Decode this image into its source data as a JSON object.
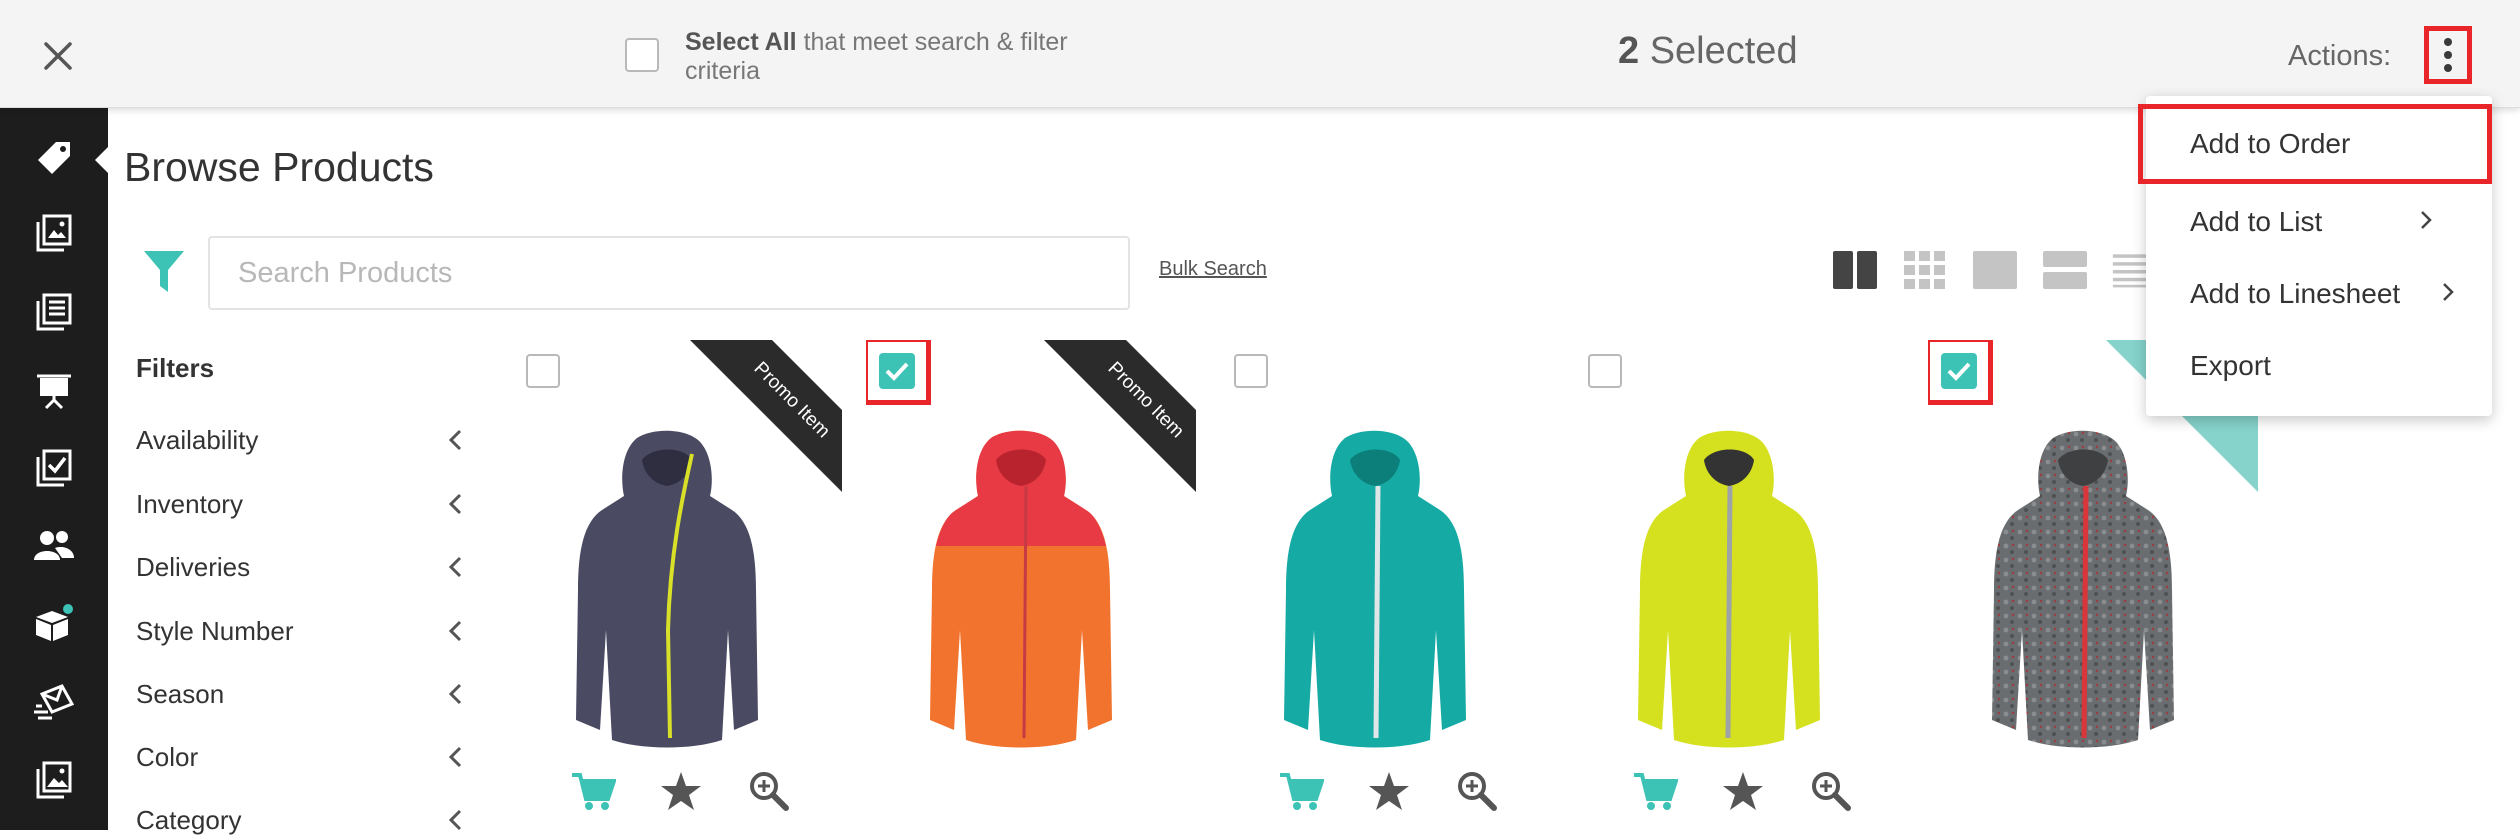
{
  "topbar": {
    "select_all_bold": "Select All",
    "select_all_rest": " that meet search & filter criteria",
    "selected_number": "2",
    "selected_label": " Selected",
    "actions_label": "Actions:"
  },
  "page": {
    "title": "Browse Products"
  },
  "search": {
    "placeholder": "Search Products",
    "value": "",
    "bulk_search": "Bulk Search"
  },
  "filters": {
    "title": "Filters",
    "items": [
      {
        "label": "Availability"
      },
      {
        "label": "Inventory"
      },
      {
        "label": "Deliveries"
      },
      {
        "label": "Style Number"
      },
      {
        "label": "Season"
      },
      {
        "label": "Color"
      },
      {
        "label": "Category"
      }
    ]
  },
  "products": [
    {
      "selected": false,
      "ribbon": "Promo Item",
      "color": "#4a4a63",
      "zip": "#d8e028",
      "actions": true
    },
    {
      "selected": true,
      "ribbon": "Promo Item",
      "color": "#f2732e",
      "zip": "#c73a44",
      "actions": false
    },
    {
      "selected": false,
      "ribbon": "",
      "color": "#16aaa5",
      "zip": "#dfe6e8",
      "actions": true
    },
    {
      "selected": false,
      "ribbon": "",
      "color": "#d5e01e",
      "zip": "#9ea3a8",
      "actions": true
    },
    {
      "selected": true,
      "ribbon": "out",
      "color": "#6a6d70",
      "zip": "#d9363b",
      "actions": false
    }
  ],
  "dropdown": {
    "items": [
      {
        "label": "Add to Order",
        "has_submenu": false
      },
      {
        "label": "Add to List",
        "has_submenu": true
      },
      {
        "label": "Add to Linesheet",
        "has_submenu": true
      },
      {
        "label": "Export",
        "has_submenu": false
      }
    ]
  },
  "colors": {
    "accent": "#3cc3b5",
    "highlight_border": "#e8262a",
    "sidebar_bg": "#1d1d1d"
  },
  "icons": {
    "sidebar": [
      "tag-icon",
      "catalog-icon",
      "list-icon",
      "presentation-icon",
      "checklist-icon",
      "users-icon",
      "box-icon",
      "mail-icon",
      "image-icon"
    ]
  }
}
